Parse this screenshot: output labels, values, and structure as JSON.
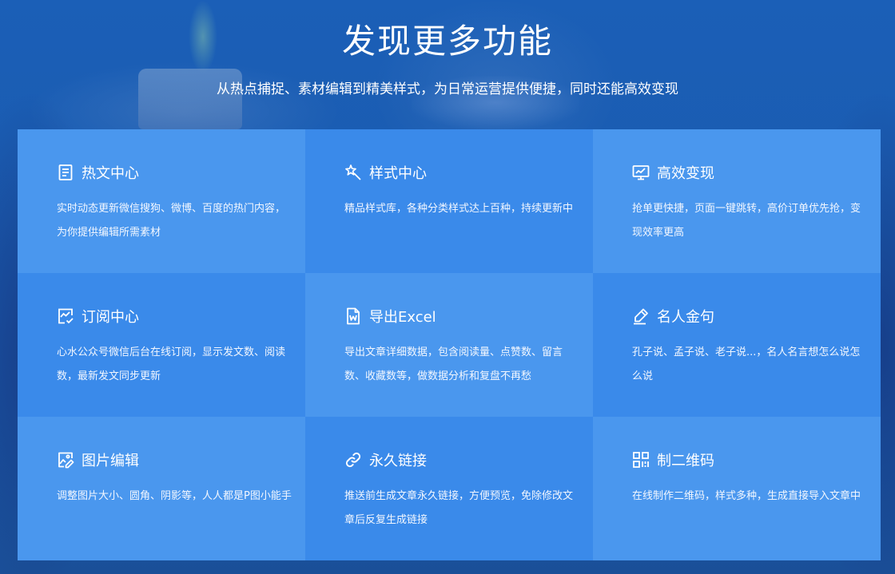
{
  "header": {
    "title": "发现更多功能",
    "subtitle": "从热点捕捉、素材编辑到精美样式，为日常运营提供便捷，同时还能高效变现"
  },
  "features": [
    {
      "icon": "document-icon",
      "title": "热文中心",
      "desc": "实时动态更新微信搜狗、微博、百度的热门内容，为你提供编辑所需素材"
    },
    {
      "icon": "magic-wand-icon",
      "title": "样式中心",
      "desc": "精品样式库，各种分类样式达上百种，持续更新中"
    },
    {
      "icon": "monitor-icon",
      "title": "高效变现",
      "desc": "抢单更快捷，页面一键跳转，高价订单优先抢，变现效率更高"
    },
    {
      "icon": "chart-check-icon",
      "title": "订阅中心",
      "desc": "心水公众号微信后台在线订阅，显示发文数、阅读数，最新发文同步更新"
    },
    {
      "icon": "word-file-icon",
      "title": "导出Excel",
      "desc": "导出文章详细数据，包含阅读量、点赞数、留言数、收藏数等，做数据分析和复盘不再愁"
    },
    {
      "icon": "pen-icon",
      "title": "名人金句",
      "desc": "孔子说、孟子说、老子说...，名人名言想怎么说怎么说"
    },
    {
      "icon": "image-edit-icon",
      "title": "图片编辑",
      "desc": "调整图片大小、圆角、阴影等，人人都是P图小能手"
    },
    {
      "icon": "link-icon",
      "title": "永久链接",
      "desc": "推送前生成文章永久链接，方便预览，免除修改文章后反复生成链接"
    },
    {
      "icon": "qrcode-icon",
      "title": "制二维码",
      "desc": "在线制作二维码，样式多种，生成直接导入文章中"
    }
  ],
  "colors": {
    "card_light": "#4a97ee",
    "card_dark": "#3a8aea",
    "background": "#1b5fb7"
  }
}
